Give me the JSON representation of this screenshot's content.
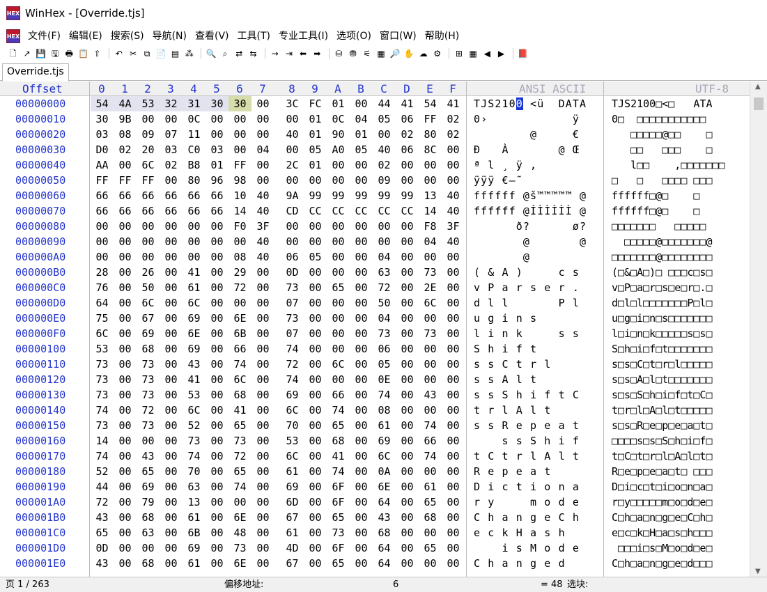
{
  "window": {
    "title": "WinHex - [Override.tjs]",
    "icon": "winhex-logo-icon"
  },
  "menu": [
    "文件(F)",
    "编辑(E)",
    "搜索(S)",
    "导航(N)",
    "查看(V)",
    "工具(T)",
    "专业工具(I)",
    "选项(O)",
    "窗口(W)",
    "帮助(H)"
  ],
  "toolbar": {
    "groups": [
      [
        {
          "name": "new-file-icon",
          "glyph": "🗋"
        },
        {
          "name": "open-file-icon",
          "glyph": "↗"
        },
        {
          "name": "save-icon",
          "glyph": "💾"
        },
        {
          "name": "save-as-icon",
          "glyph": "🖫"
        },
        {
          "name": "print-icon",
          "glyph": "🖶"
        },
        {
          "name": "properties-icon",
          "glyph": "📋"
        },
        {
          "name": "export-icon",
          "glyph": "⇧"
        }
      ],
      [
        {
          "name": "undo-icon",
          "glyph": "↶"
        },
        {
          "name": "cut-icon",
          "glyph": "✂"
        },
        {
          "name": "copy-icon",
          "glyph": "⧉"
        },
        {
          "name": "paste-icon",
          "glyph": "📄"
        },
        {
          "name": "paste-write-icon",
          "glyph": "▤"
        },
        {
          "name": "hex-paste-icon",
          "glyph": "⁂"
        }
      ],
      [
        {
          "name": "find-icon",
          "glyph": "🔍"
        },
        {
          "name": "find-hex-icon",
          "glyph": "⌕"
        },
        {
          "name": "replace-text-icon",
          "glyph": "⇄"
        },
        {
          "name": "replace-hex-icon",
          "glyph": "⇆"
        }
      ],
      [
        {
          "name": "goto-offset-icon",
          "glyph": "→"
        },
        {
          "name": "goto-sector-icon",
          "glyph": "⇥"
        },
        {
          "name": "back-icon",
          "glyph": "⬅"
        },
        {
          "name": "forward-icon",
          "glyph": "➡"
        }
      ],
      [
        {
          "name": "open-disk-icon",
          "glyph": "⛁"
        },
        {
          "name": "disk-edit-icon",
          "glyph": "⛃"
        },
        {
          "name": "ram-icon",
          "glyph": "⚟"
        },
        {
          "name": "calculator-icon",
          "glyph": "▦"
        },
        {
          "name": "magnifier-icon",
          "glyph": "🔎"
        },
        {
          "name": "hand-icon",
          "glyph": "✋"
        },
        {
          "name": "bookmark-icon",
          "glyph": "☁"
        },
        {
          "name": "gear-icon",
          "glyph": "⚙"
        }
      ],
      [
        {
          "name": "position-manager-icon",
          "glyph": "⊞"
        },
        {
          "name": "grid-icon",
          "glyph": "▦"
        },
        {
          "name": "prev-block-icon",
          "glyph": "◀"
        },
        {
          "name": "next-block-icon",
          "glyph": "▶"
        }
      ],
      [
        {
          "name": "help-book-icon",
          "glyph": "📕"
        }
      ]
    ]
  },
  "tab": {
    "label": "Override.tjs"
  },
  "header": {
    "offset": "Offset",
    "columns": [
      "0",
      "1",
      "2",
      "3",
      "4",
      "5",
      "6",
      "7",
      "8",
      "9",
      "A",
      "B",
      "C",
      "D",
      "E",
      "F"
    ],
    "ansi": "ANSI ASCII",
    "utf8": "UTF-8"
  },
  "rows": [
    {
      "off": "00000000",
      "hex": [
        "54",
        "4A",
        "53",
        "32",
        "31",
        "30",
        "30",
        "00",
        "3C",
        "FC",
        "01",
        "00",
        "44",
        "41",
        "54",
        "41"
      ],
      "ascii": "TJS2100 <ü  DATA",
      "utf": "TJS2100□<□   ATA"
    },
    {
      "off": "00000010",
      "hex": [
        "30",
        "9B",
        "00",
        "00",
        "0C",
        "00",
        "00",
        "00",
        "00",
        "01",
        "0C",
        "04",
        "05",
        "06",
        "FF",
        "02"
      ],
      "ascii": "0›            ÿ ",
      "utf": "0□  □□□□□□□□□□□"
    },
    {
      "off": "00000020",
      "hex": [
        "03",
        "08",
        "09",
        "07",
        "11",
        "00",
        "00",
        "00",
        "40",
        "01",
        "90",
        "01",
        "00",
        "02",
        "80",
        "02"
      ],
      "ascii": "        @     € ",
      "utf": "   □□□□□@□□    □"
    },
    {
      "off": "00000030",
      "hex": [
        "D0",
        "02",
        "20",
        "03",
        "C0",
        "03",
        "00",
        "04",
        "00",
        "05",
        "A0",
        "05",
        "40",
        "06",
        "8C",
        "00"
      ],
      "ascii": "Ð   À       @ Œ ",
      "utf": "   □□   □□□    □"
    },
    {
      "off": "00000040",
      "hex": [
        "AA",
        "00",
        "6C",
        "02",
        "B8",
        "01",
        "FF",
        "00",
        "2C",
        "01",
        "00",
        "00",
        "02",
        "00",
        "00",
        "00"
      ],
      "ascii": "ª l ¸ ÿ ,       ",
      "utf": "   l□□    ,□□□□□□□"
    },
    {
      "off": "00000050",
      "hex": [
        "FF",
        "FF",
        "FF",
        "00",
        "80",
        "96",
        "98",
        "00",
        "00",
        "00",
        "00",
        "00",
        "09",
        "00",
        "00",
        "00"
      ],
      "ascii": "ÿÿÿ €–˜         ",
      "utf": "□   □   □□□□ □□□"
    },
    {
      "off": "00000060",
      "hex": [
        "66",
        "66",
        "66",
        "66",
        "66",
        "66",
        "10",
        "40",
        "9A",
        "99",
        "99",
        "99",
        "99",
        "99",
        "13",
        "40"
      ],
      "ascii": "ffffff @š™™™™™ @",
      "utf": "ffffff□@□    □"
    },
    {
      "off": "00000070",
      "hex": [
        "66",
        "66",
        "66",
        "66",
        "66",
        "66",
        "14",
        "40",
        "CD",
        "CC",
        "CC",
        "CC",
        "CC",
        "CC",
        "14",
        "40"
      ],
      "ascii": "ffffff @ÍÌÌÌÌÌ @",
      "utf": "ffffff□@□    □"
    },
    {
      "off": "00000080",
      "hex": [
        "00",
        "00",
        "00",
        "00",
        "00",
        "00",
        "F0",
        "3F",
        "00",
        "00",
        "00",
        "00",
        "00",
        "00",
        "F8",
        "3F"
      ],
      "ascii": "      ð?      ø?",
      "utf": "□□□□□□□   □□□□□"
    },
    {
      "off": "00000090",
      "hex": [
        "00",
        "00",
        "00",
        "00",
        "00",
        "00",
        "00",
        "40",
        "00",
        "00",
        "00",
        "00",
        "00",
        "00",
        "04",
        "40"
      ],
      "ascii": "       @       @",
      "utf": "  □□□□□@□□□□□□□@"
    },
    {
      "off": "000000A0",
      "hex": [
        "00",
        "00",
        "00",
        "00",
        "00",
        "00",
        "08",
        "40",
        "06",
        "05",
        "00",
        "00",
        "04",
        "00",
        "00",
        "00"
      ],
      "ascii": "       @        ",
      "utf": "□□□□□□□@□□□□□□□□"
    },
    {
      "off": "000000B0",
      "hex": [
        "28",
        "00",
        "26",
        "00",
        "41",
        "00",
        "29",
        "00",
        "0D",
        "00",
        "00",
        "00",
        "63",
        "00",
        "73",
        "00"
      ],
      "ascii": "( & A )     c s ",
      "utf": "(□&□A□)□ □□□c□s□"
    },
    {
      "off": "000000C0",
      "hex": [
        "76",
        "00",
        "50",
        "00",
        "61",
        "00",
        "72",
        "00",
        "73",
        "00",
        "65",
        "00",
        "72",
        "00",
        "2E",
        "00"
      ],
      "ascii": "v P a r s e r . ",
      "utf": "v□P□a□r□s□e□r□.□"
    },
    {
      "off": "000000D0",
      "hex": [
        "64",
        "00",
        "6C",
        "00",
        "6C",
        "00",
        "00",
        "00",
        "07",
        "00",
        "00",
        "00",
        "50",
        "00",
        "6C",
        "00"
      ],
      "ascii": "d l l       P l ",
      "utf": "d□l□l□□□□□□□P□l□"
    },
    {
      "off": "000000E0",
      "hex": [
        "75",
        "00",
        "67",
        "00",
        "69",
        "00",
        "6E",
        "00",
        "73",
        "00",
        "00",
        "00",
        "04",
        "00",
        "00",
        "00"
      ],
      "ascii": "u g i n s       ",
      "utf": "u□g□i□n□s□□□□□□□"
    },
    {
      "off": "000000F0",
      "hex": [
        "6C",
        "00",
        "69",
        "00",
        "6E",
        "00",
        "6B",
        "00",
        "07",
        "00",
        "00",
        "00",
        "73",
        "00",
        "73",
        "00"
      ],
      "ascii": "l i n k     s s ",
      "utf": "l□i□n□k□□□□□s□s□"
    },
    {
      "off": "00000100",
      "hex": [
        "53",
        "00",
        "68",
        "00",
        "69",
        "00",
        "66",
        "00",
        "74",
        "00",
        "00",
        "00",
        "06",
        "00",
        "00",
        "00"
      ],
      "ascii": "S h i f t       ",
      "utf": "S□h□i□f□t□□□□□□□"
    },
    {
      "off": "00000110",
      "hex": [
        "73",
        "00",
        "73",
        "00",
        "43",
        "00",
        "74",
        "00",
        "72",
        "00",
        "6C",
        "00",
        "05",
        "00",
        "00",
        "00"
      ],
      "ascii": "s s C t r l     ",
      "utf": "s□s□C□t□r□l□□□□□"
    },
    {
      "off": "00000120",
      "hex": [
        "73",
        "00",
        "73",
        "00",
        "41",
        "00",
        "6C",
        "00",
        "74",
        "00",
        "00",
        "00",
        "0E",
        "00",
        "00",
        "00"
      ],
      "ascii": "s s A l t       ",
      "utf": "s□s□A□l□t□□□□□□□"
    },
    {
      "off": "00000130",
      "hex": [
        "73",
        "00",
        "73",
        "00",
        "53",
        "00",
        "68",
        "00",
        "69",
        "00",
        "66",
        "00",
        "74",
        "00",
        "43",
        "00"
      ],
      "ascii": "s s S h i f t C ",
      "utf": "s□s□S□h□i□f□t□C□"
    },
    {
      "off": "00000140",
      "hex": [
        "74",
        "00",
        "72",
        "00",
        "6C",
        "00",
        "41",
        "00",
        "6C",
        "00",
        "74",
        "00",
        "08",
        "00",
        "00",
        "00"
      ],
      "ascii": "t r l A l t     ",
      "utf": "t□r□l□A□l□t□□□□□"
    },
    {
      "off": "00000150",
      "hex": [
        "73",
        "00",
        "73",
        "00",
        "52",
        "00",
        "65",
        "00",
        "70",
        "00",
        "65",
        "00",
        "61",
        "00",
        "74",
        "00"
      ],
      "ascii": "s s R e p e a t ",
      "utf": "s□s□R□e□p□e□a□t□"
    },
    {
      "off": "00000160",
      "hex": [
        "14",
        "00",
        "00",
        "00",
        "73",
        "00",
        "73",
        "00",
        "53",
        "00",
        "68",
        "00",
        "69",
        "00",
        "66",
        "00"
      ],
      "ascii": "    s s S h i f ",
      "utf": "□□□□s□s□S□h□i□f□"
    },
    {
      "off": "00000170",
      "hex": [
        "74",
        "00",
        "43",
        "00",
        "74",
        "00",
        "72",
        "00",
        "6C",
        "00",
        "41",
        "00",
        "6C",
        "00",
        "74",
        "00"
      ],
      "ascii": "t C t r l A l t ",
      "utf": "t□C□t□r□l□A□l□t□"
    },
    {
      "off": "00000180",
      "hex": [
        "52",
        "00",
        "65",
        "00",
        "70",
        "00",
        "65",
        "00",
        "61",
        "00",
        "74",
        "00",
        "0A",
        "00",
        "00",
        "00"
      ],
      "ascii": "R e p e a t     ",
      "utf": "R□e□p□e□a□t□ □□□"
    },
    {
      "off": "00000190",
      "hex": [
        "44",
        "00",
        "69",
        "00",
        "63",
        "00",
        "74",
        "00",
        "69",
        "00",
        "6F",
        "00",
        "6E",
        "00",
        "61",
        "00"
      ],
      "ascii": "D i c t i o n a ",
      "utf": "D□i□c□t□i□o□n□a□"
    },
    {
      "off": "000001A0",
      "hex": [
        "72",
        "00",
        "79",
        "00",
        "13",
        "00",
        "00",
        "00",
        "6D",
        "00",
        "6F",
        "00",
        "64",
        "00",
        "65",
        "00"
      ],
      "ascii": "r y     m o d e ",
      "utf": "r□y□□□□□m□o□d□e□"
    },
    {
      "off": "000001B0",
      "hex": [
        "43",
        "00",
        "68",
        "00",
        "61",
        "00",
        "6E",
        "00",
        "67",
        "00",
        "65",
        "00",
        "43",
        "00",
        "68",
        "00"
      ],
      "ascii": "C h a n g e C h ",
      "utf": "C□h□a□n□g□e□C□h□"
    },
    {
      "off": "000001C0",
      "hex": [
        "65",
        "00",
        "63",
        "00",
        "6B",
        "00",
        "48",
        "00",
        "61",
        "00",
        "73",
        "00",
        "68",
        "00",
        "00",
        "00"
      ],
      "ascii": "e c k H a s h   ",
      "utf": "e□c□k□H□a□s□h□□□"
    },
    {
      "off": "000001D0",
      "hex": [
        "0D",
        "00",
        "00",
        "00",
        "69",
        "00",
        "73",
        "00",
        "4D",
        "00",
        "6F",
        "00",
        "64",
        "00",
        "65",
        "00"
      ],
      "ascii": "    i s M o d e ",
      "utf": " □□□i□s□M□o□d□e□"
    },
    {
      "off": "000001E0",
      "hex": [
        "43",
        "00",
        "68",
        "00",
        "61",
        "00",
        "6E",
        "00",
        "67",
        "00",
        "65",
        "00",
        "64",
        "00",
        "00",
        "00"
      ],
      "ascii": "C h a n g e d   ",
      "utf": "C□h□a□n□g□e□d□□□"
    }
  ],
  "selection": {
    "row": 0,
    "selected_bytes": 6,
    "cursor_byte": 6
  },
  "status": {
    "page": "页 1 / 263",
    "offset_label": "偏移地址:",
    "offset_value": "6",
    "sel_value": "= 48",
    "sel_label": "选块:"
  },
  "colors": {
    "offset_blue": "#2233cc",
    "selection_bg": "#e3e3f0",
    "cursor_bg": "#d6dcaa",
    "caret": "#1a36d8"
  }
}
